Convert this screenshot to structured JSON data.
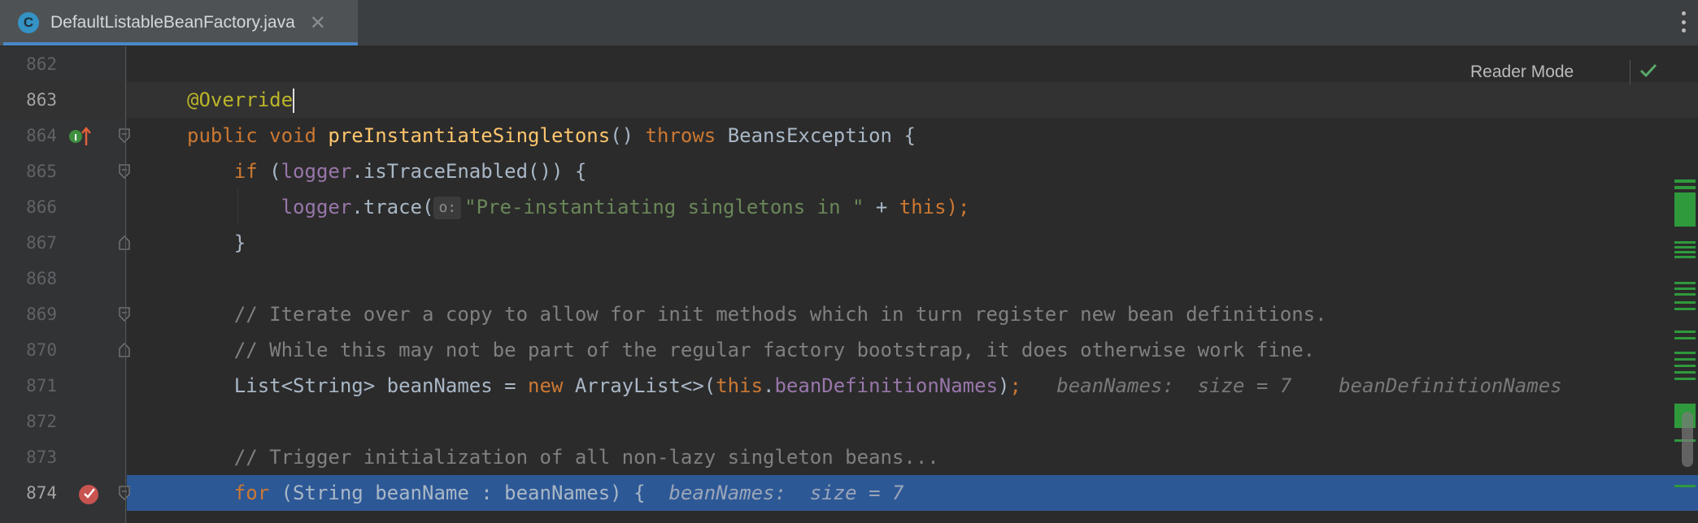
{
  "tab": {
    "icon_letter": "C",
    "title": "DefaultListableBeanFactory.java",
    "close_glyph": "✕"
  },
  "editor": {
    "reader_mode_label": "Reader Mode",
    "current_line": 863,
    "execution_line": 874,
    "lines": [
      {
        "num": "862"
      },
      {
        "num": "863",
        "annotation": "@Override"
      },
      {
        "num": "864",
        "kw1": "public",
        "kw2": "void",
        "method": "preInstantiateSingletons",
        "paren": "() ",
        "kw3": "throws",
        "rest": " BeansException {"
      },
      {
        "num": "865",
        "indent": "    ",
        "kw": "if",
        "p1": " (",
        "field": "logger",
        "rest": ".isTraceEnabled()) {"
      },
      {
        "num": "866",
        "indent": "        ",
        "field": "logger",
        "call": ".trace(",
        "param_hint": "o:",
        "string": "\"Pre-instantiating singletons in \"",
        "plus": " + ",
        "kw": "this",
        "end": ");"
      },
      {
        "num": "867",
        "indent": "    ",
        "text": "}"
      },
      {
        "num": "868"
      },
      {
        "num": "869",
        "indent": "    ",
        "comment": "// Iterate over a copy to allow for init methods which in turn register new bean definitions."
      },
      {
        "num": "870",
        "indent": "    ",
        "comment": "// While this may not be part of the regular factory bootstrap, it does otherwise work fine."
      },
      {
        "num": "871",
        "indent": "    ",
        "t1": "List<String> beanNames = ",
        "kw_new": "new",
        "t2": " ArrayList<>(",
        "kw_this": "this",
        "dot": ".",
        "field": "beanDefinitionNames",
        "t3": ")",
        "semi": ";",
        "hint": "   beanNames:  size = 7    beanDefinitionNames"
      },
      {
        "num": "872"
      },
      {
        "num": "873",
        "indent": "    ",
        "comment": "// Trigger initialization of all non-lazy singleton beans..."
      },
      {
        "num": "874",
        "indent": "    ",
        "kw": "for",
        "rest": " (String beanName : beanNames) {",
        "hint": "  beanNames:  size = 7"
      }
    ]
  },
  "colors": {
    "editor_bg": "#2b2b2b",
    "keyword": "#cc7832",
    "annotation": "#bbb529",
    "method": "#ffc66d",
    "field": "#9876aa",
    "string": "#6a8759",
    "comment": "#808080",
    "execution_line": "#2d5896",
    "tab_underline": "#4a88c7"
  },
  "icons": [
    "class-c-icon",
    "close-icon",
    "more-vertical-icon",
    "implements-up-icon",
    "breakpoint-verified-icon",
    "fold-icon",
    "checkmark-icon"
  ]
}
